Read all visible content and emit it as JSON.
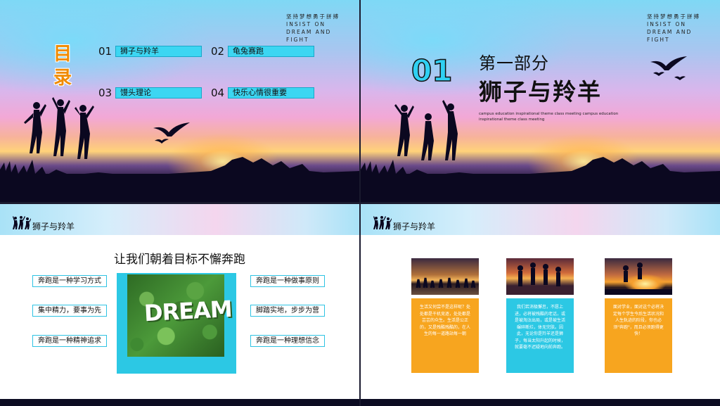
{
  "motto": {
    "line1": "坚持梦想勇于拼搏",
    "line2": "INSIST ON",
    "line3": "DREAM AND",
    "line4": "FIGHT"
  },
  "slide1": {
    "title_char1": "目",
    "title_char2": "录",
    "items": [
      {
        "num": "01",
        "label": "狮子与羚羊"
      },
      {
        "num": "02",
        "label": "龟兔赛跑"
      },
      {
        "num": "03",
        "label": "馒头理论"
      },
      {
        "num": "04",
        "label": "快乐心情很重要"
      }
    ]
  },
  "slide2": {
    "number": "01",
    "part": "第一部分",
    "title": "狮子与羚羊",
    "subtitle": "campus education inspirational theme class meeting campus education inspirational theme class meeting"
  },
  "slide3": {
    "header": "狮子与羚羊",
    "title": "让我们朝着目标不懈奔跑",
    "left_pills": [
      "奔跑是一种学习方式",
      "集中精力，要事为先",
      "奔跑是一种精神追求"
    ],
    "right_pills": [
      "奔跑是一种做事原则",
      "脚踏实地，步步为营",
      "奔跑是一种理想信念"
    ],
    "image_word": "DREAM"
  },
  "slide4": {
    "header": "狮子与羚羊",
    "cards": [
      {
        "text": "生活又何尝不是这样呢？处处都是干机竞逐，处处都是芸芸的众生。生活是公正的，又是残酷残酷的，在人生的每一道路站每一朝",
        "color": "#f7a51f"
      },
      {
        "text": "我们若消极懈怠，不愿上进，必将被残酷的老话，或是被淘汰出局，或是被生活碾碎断烂，体无完肤。因此，无论你是羚羊还是狮子，每当太阳升起的时候，就要毫不迟疑地向前奔跑。",
        "color": "#2cc8e4"
      },
      {
        "text": "面对学业，面对这个必将决定每个学生今后生活状况和人生轨迹的阶段，你也必须\"奔跑\"，而且必须跑得更快！",
        "color": "#f7a51f"
      }
    ]
  }
}
